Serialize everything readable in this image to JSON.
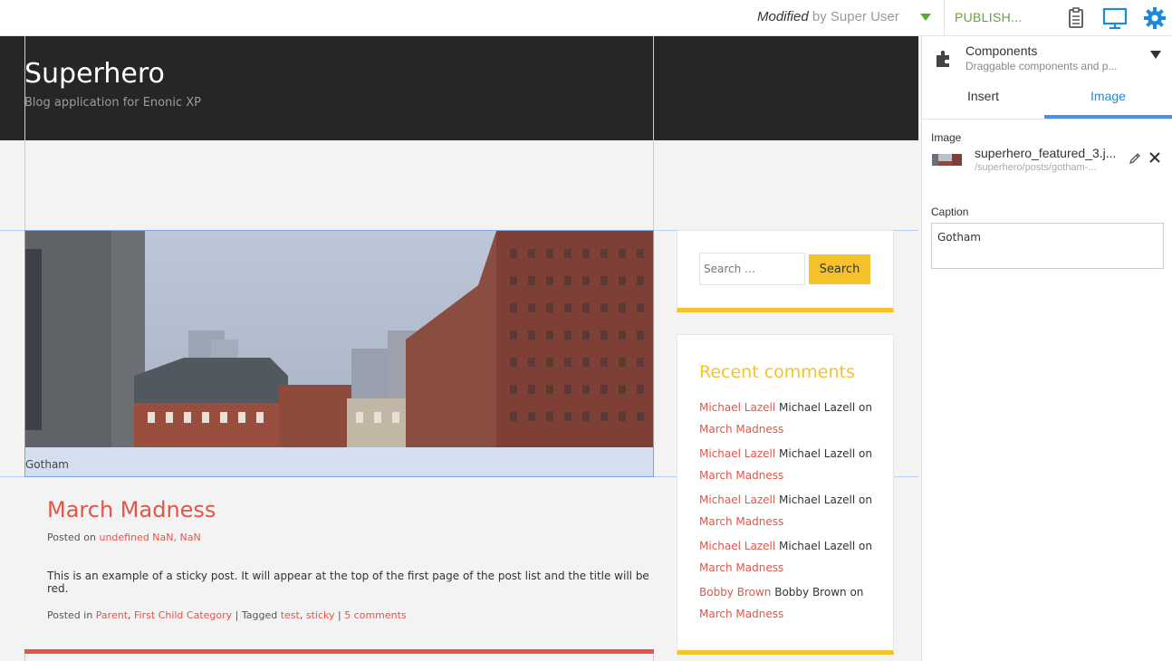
{
  "toolbar": {
    "status_label": "Modified",
    "status_by": "by Super User",
    "publish_label": "PUBLISH...",
    "icons": [
      "dropdown-caret",
      "clipboard-icon",
      "monitor-icon",
      "gear-icon"
    ],
    "accent_color": "#5ea82e"
  },
  "site": {
    "title": "Superhero",
    "tagline": "Blog application for Enonic XP"
  },
  "image_part": {
    "caption": "Gotham"
  },
  "post": {
    "title": "March Madness",
    "posted_on_label": "Posted on",
    "posted_on_value": "undefined NaN, NaN",
    "body": "This is an example of a sticky post. It will appear at the top of the first page of the post list and the title will be red.",
    "posted_in_label": "Posted in",
    "category_1": "Parent",
    "category_2": "First Child Category",
    "tagged_label": "| Tagged",
    "tag_1": "test",
    "tag_2": "sticky",
    "comments_link": "5 comments",
    "accent_color": "#e25547"
  },
  "search_widget": {
    "placeholder": "Search …",
    "button_label": "Search"
  },
  "recent_comments": {
    "title": "Recent comments",
    "items": [
      {
        "author_link": "Michael Lazell",
        "author": "Michael Lazell",
        "on": "on",
        "post": "March Madness"
      },
      {
        "author_link": "Michael Lazell",
        "author": "Michael Lazell",
        "on": "on",
        "post": "March Madness"
      },
      {
        "author_link": "Michael Lazell",
        "author": "Michael Lazell",
        "on": "on",
        "post": "March Madness"
      },
      {
        "author_link": "Michael Lazell",
        "author": "Michael Lazell",
        "on": "on",
        "post": "March Madness"
      },
      {
        "author_link": "Bobby Brown",
        "author": "Bobby Brown",
        "on": "on",
        "post": "March Madness"
      }
    ],
    "accent_color": "#f6c22b"
  },
  "panel": {
    "title": "Components",
    "subtitle": "Draggable components and p...",
    "tabs": [
      "Insert",
      "Image"
    ],
    "active_tab": "Image",
    "image_label": "Image",
    "file_name": "superhero_featured_3.j...",
    "file_path": "/superhero/posts/gotham-...",
    "caption_label": "Caption",
    "caption_value": "Gotham",
    "icons": [
      "puzzle-icon",
      "edit-icon",
      "close-icon"
    ],
    "accent_color": "#4a90e2"
  }
}
